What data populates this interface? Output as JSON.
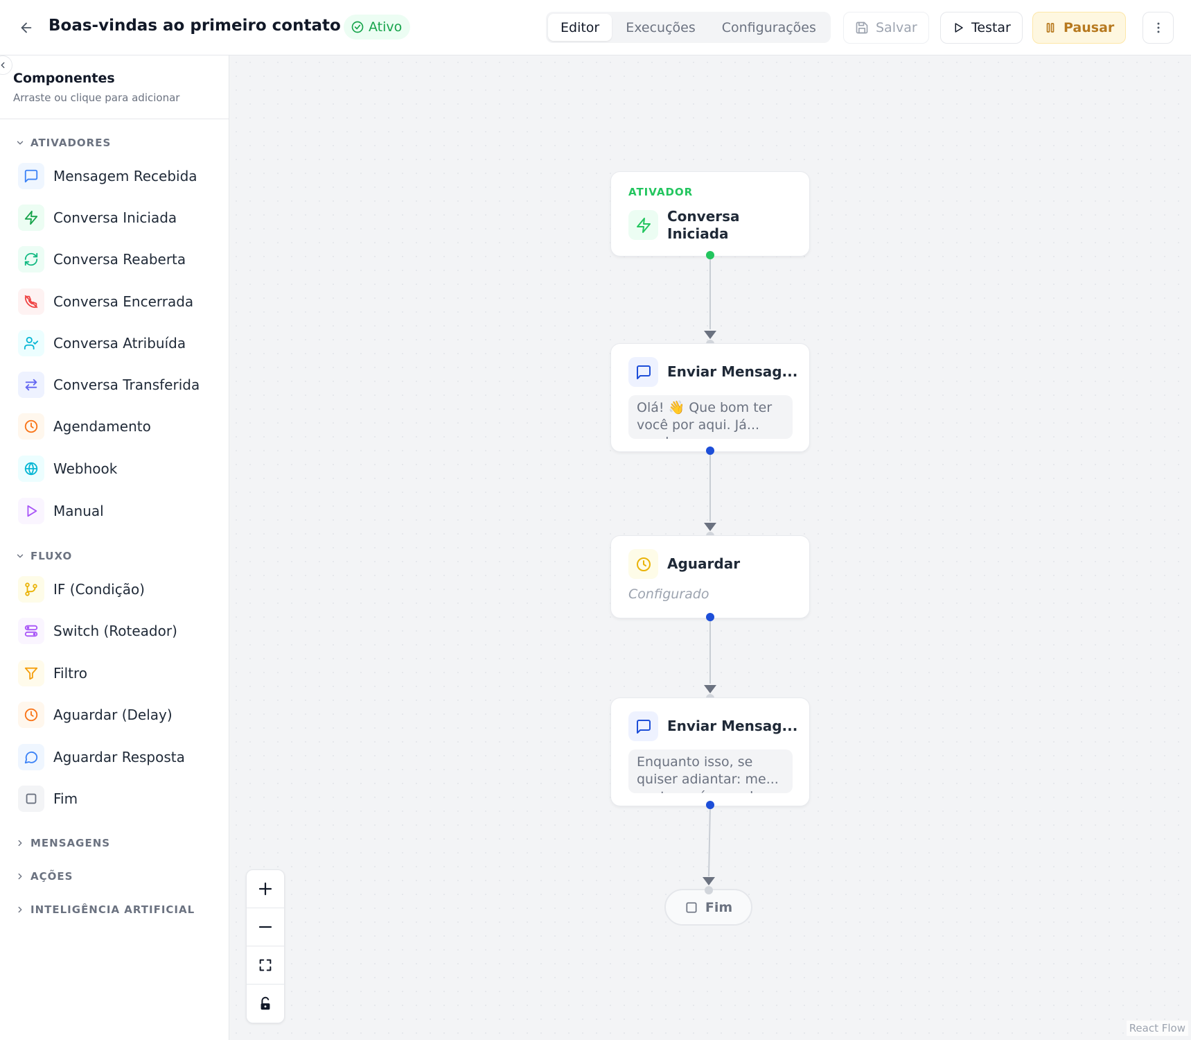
{
  "header": {
    "title": "Boas-vindas ao primeiro contato",
    "status": "Ativo",
    "tabs": [
      {
        "label": "Editor",
        "active": true
      },
      {
        "label": "Execuções",
        "active": false
      },
      {
        "label": "Configurações",
        "active": false
      }
    ],
    "save_label": "Salvar",
    "test_label": "Testar",
    "pause_label": "Pausar"
  },
  "sidebar": {
    "title": "Componentes",
    "subtitle": "Arraste ou clique para adicionar",
    "sections": [
      {
        "label": "ATIVADORES",
        "expanded": true,
        "items": [
          {
            "label": "Mensagem Recebida",
            "icon": "message-square-icon",
            "color": "#3b82f6",
            "bg": "#eff6ff"
          },
          {
            "label": "Conversa Iniciada",
            "icon": "zap-icon",
            "color": "#16a34a",
            "bg": "#ecfdf3"
          },
          {
            "label": "Conversa Reaberta",
            "icon": "refresh-icon",
            "color": "#10b981",
            "bg": "#ecfdf5"
          },
          {
            "label": "Conversa Encerrada",
            "icon": "phone-off-icon",
            "color": "#ef4444",
            "bg": "#fef2f2"
          },
          {
            "label": "Conversa Atribuída",
            "icon": "user-check-icon",
            "color": "#06b6d4",
            "bg": "#ecfeff"
          },
          {
            "label": "Conversa Transferida",
            "icon": "arrows-swap-icon",
            "color": "#6366f1",
            "bg": "#eef2ff"
          },
          {
            "label": "Agendamento",
            "icon": "clock-icon",
            "color": "#f97316",
            "bg": "#fff7ed"
          },
          {
            "label": "Webhook",
            "icon": "globe-icon",
            "color": "#06b6d4",
            "bg": "#ecfeff"
          },
          {
            "label": "Manual",
            "icon": "play-icon",
            "color": "#a855f7",
            "bg": "#faf5ff"
          }
        ]
      },
      {
        "label": "FLUXO",
        "expanded": true,
        "items": [
          {
            "label": "IF (Condição)",
            "icon": "git-branch-icon",
            "color": "#eab308",
            "bg": "#fefce8"
          },
          {
            "label": "Switch (Roteador)",
            "icon": "route-icon",
            "color": "#a855f7",
            "bg": "#faf5ff"
          },
          {
            "label": "Filtro",
            "icon": "filter-icon",
            "color": "#f59e0b",
            "bg": "#fffbeb"
          },
          {
            "label": "Aguardar (Delay)",
            "icon": "clock-icon",
            "color": "#f97316",
            "bg": "#fff7ed"
          },
          {
            "label": "Aguardar Resposta",
            "icon": "message-circle-icon",
            "color": "#3b82f6",
            "bg": "#eff6ff"
          },
          {
            "label": "Fim",
            "icon": "square-icon",
            "color": "#6b7280",
            "bg": "#f3f4f6"
          }
        ]
      },
      {
        "label": "MENSAGENS",
        "expanded": false,
        "items": []
      },
      {
        "label": "AÇÕES",
        "expanded": false,
        "items": []
      },
      {
        "label": "INTELIGÊNCIA ARTIFICIAL",
        "expanded": false,
        "items": []
      }
    ]
  },
  "flow": {
    "nodes": [
      {
        "tag": "ATIVADOR",
        "title_line1": "Conversa",
        "title_line2": "Iniciada",
        "icon": "zap-icon",
        "color": "#22c55e"
      },
      {
        "title": "Enviar Mensag...",
        "preview": "Olá! 👋 Que bom ter você por aqui. Já... recebemos sua",
        "icon": "message-square-icon",
        "color": "#1d4ed8"
      },
      {
        "title": "Aguardar",
        "status": "Configurado",
        "icon": "clock-icon",
        "color": "#eab308"
      },
      {
        "title": "Enviar Mensag...",
        "preview": "Enquanto isso, se quiser adiantar: me... conte o número do",
        "icon": "message-square-icon",
        "color": "#1d4ed8"
      }
    ],
    "end_label": "Fim"
  },
  "attribution": "React Flow"
}
